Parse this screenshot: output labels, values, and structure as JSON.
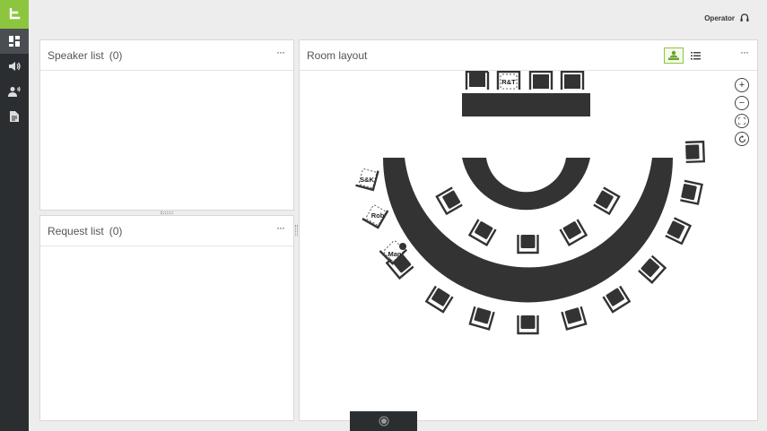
{
  "app": {
    "logo_icon": "brand-logo-icon",
    "accent_color": "#8cc63f"
  },
  "sidebar": {
    "items": [
      {
        "name": "dashboard",
        "icon": "dashboard-icon",
        "active": true
      },
      {
        "name": "audio",
        "icon": "speaker-icon",
        "active": false
      },
      {
        "name": "participants",
        "icon": "participants-icon",
        "active": false
      },
      {
        "name": "documents",
        "icon": "document-icon",
        "active": false
      }
    ]
  },
  "header": {
    "user_label": "Operator",
    "user_icon": "headset-icon"
  },
  "speaker_list": {
    "title": "Speaker list",
    "count": "(0)",
    "menu": "···"
  },
  "request_list": {
    "title": "Request list",
    "count": "(0)",
    "menu": "···"
  },
  "room_layout": {
    "title": "Room layout",
    "menu": "···",
    "view_options": [
      "seat-view",
      "list-view"
    ],
    "zoom_controls": {
      "zoom_in": "+",
      "zoom_out": "−",
      "fit": "fit",
      "reset": "reset"
    },
    "seat_labels": {
      "rt": "R&T",
      "sk": "S&K",
      "rob": "Rob",
      "man": "Man"
    }
  },
  "bottom_bar": {
    "icon": "record-icon"
  }
}
